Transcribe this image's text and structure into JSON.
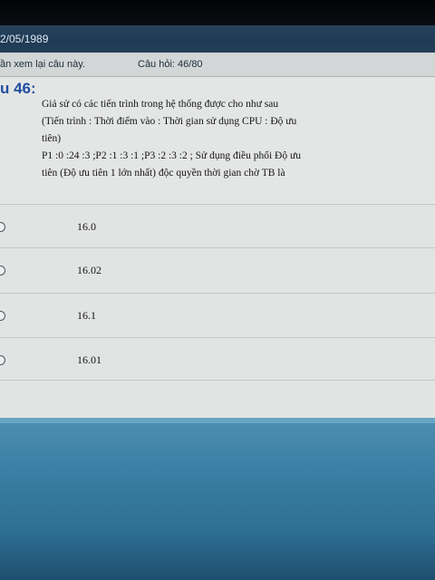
{
  "header": {
    "date": "2/05/1989"
  },
  "info_bar": {
    "review_text": "ần xem lại câu này.",
    "question_counter": "Câu hỏi: 46/80"
  },
  "question": {
    "title": "u 46:",
    "lines": [
      "Giả sử có các tiến trình trong hệ thống được cho như sau",
      "(Tiến trình : Thời điểm vào : Thời gian sử dụng CPU : Độ ưu",
      "tiên)",
      "P1 :0 :24 :3 ;P2 :1 :3 :1 ;P3 :2 :3 :2 ; Sử dụng điều phối Độ ưu",
      "tiên (Độ ưu tiên 1 lớn nhất)  độc quyền thời gian chờ TB là"
    ]
  },
  "answers": [
    {
      "label": "16.0"
    },
    {
      "label": "16.02"
    },
    {
      "label": "16.1"
    },
    {
      "label": "16.01"
    }
  ],
  "colors": {
    "header_bg": "#1e3a55",
    "question_title": "#1f4ea0",
    "panel_bg": "#e4e6e5",
    "footer_bg": "#3b80a6"
  }
}
